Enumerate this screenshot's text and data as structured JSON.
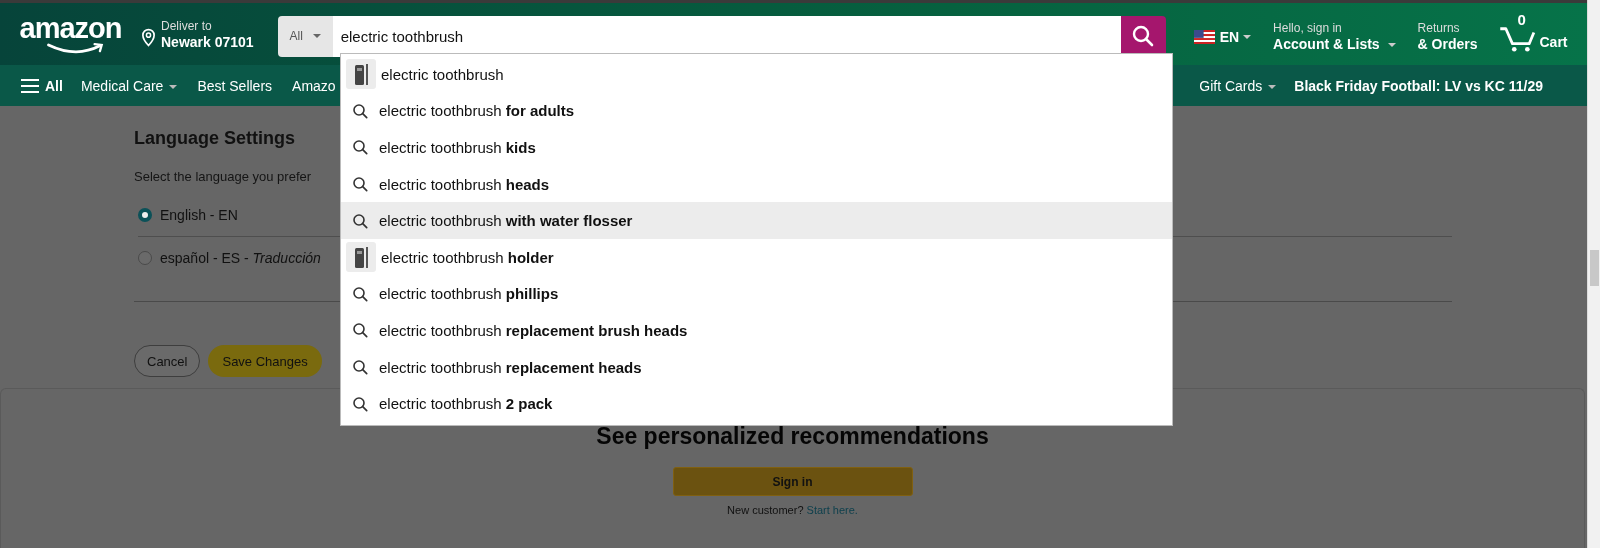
{
  "header": {
    "logo": "amazon",
    "deliver_label": "Deliver to",
    "deliver_location": "Newark 07101",
    "search": {
      "category": "All",
      "value": "electric toothbrush"
    },
    "language": "EN",
    "account_greeting": "Hello, sign in",
    "account_label": "Account & Lists",
    "returns_label": "Returns",
    "orders_label": "& Orders",
    "cart_count": "0",
    "cart_label": "Cart"
  },
  "nav": {
    "all_label": "All",
    "items": [
      {
        "label": "Medical Care",
        "caret": true
      },
      {
        "label": "Best Sellers",
        "caret": false
      },
      {
        "label": "Amazo",
        "caret": false
      }
    ],
    "right_items": [
      {
        "label": "Gift Cards",
        "caret": true
      }
    ],
    "promo": "Black Friday Football: LV vs KC 11/29"
  },
  "suggestions": [
    {
      "kind": "image",
      "text": "electric toothbrush",
      "selected": false
    },
    {
      "kind": "search",
      "text": "electric toothbrush **for adults**",
      "selected": false
    },
    {
      "kind": "search",
      "text": "electric toothbrush **kids**",
      "selected": false
    },
    {
      "kind": "search",
      "text": "electric toothbrush **heads**",
      "selected": false
    },
    {
      "kind": "search",
      "text": "electric toothbrush **with water flosser**",
      "selected": true
    },
    {
      "kind": "image",
      "text": "electric toothbrush **holder**",
      "selected": false
    },
    {
      "kind": "search",
      "text": "electric toothbrush **phillips**",
      "selected": false
    },
    {
      "kind": "search",
      "text": "electric toothbrush **replacement brush heads**",
      "selected": false
    },
    {
      "kind": "search",
      "text": "electric toothbrush **replacement heads**",
      "selected": false
    },
    {
      "kind": "search",
      "text": "electric toothbrush **2 pack**",
      "selected": false
    }
  ],
  "settings": {
    "title": "Language Settings",
    "prompt": "Select the language you prefer",
    "languages": [
      {
        "label": "English - EN",
        "selected": true
      },
      {
        "label": "español - ES - *Traducción*",
        "selected": false
      }
    ],
    "buttons": {
      "cancel": "Cancel",
      "save": "Save Changes"
    }
  },
  "recommendations": {
    "title": "See personalized recommendations",
    "button": "Sign in",
    "new_customer": "New customer?",
    "start_link": "Start here."
  }
}
